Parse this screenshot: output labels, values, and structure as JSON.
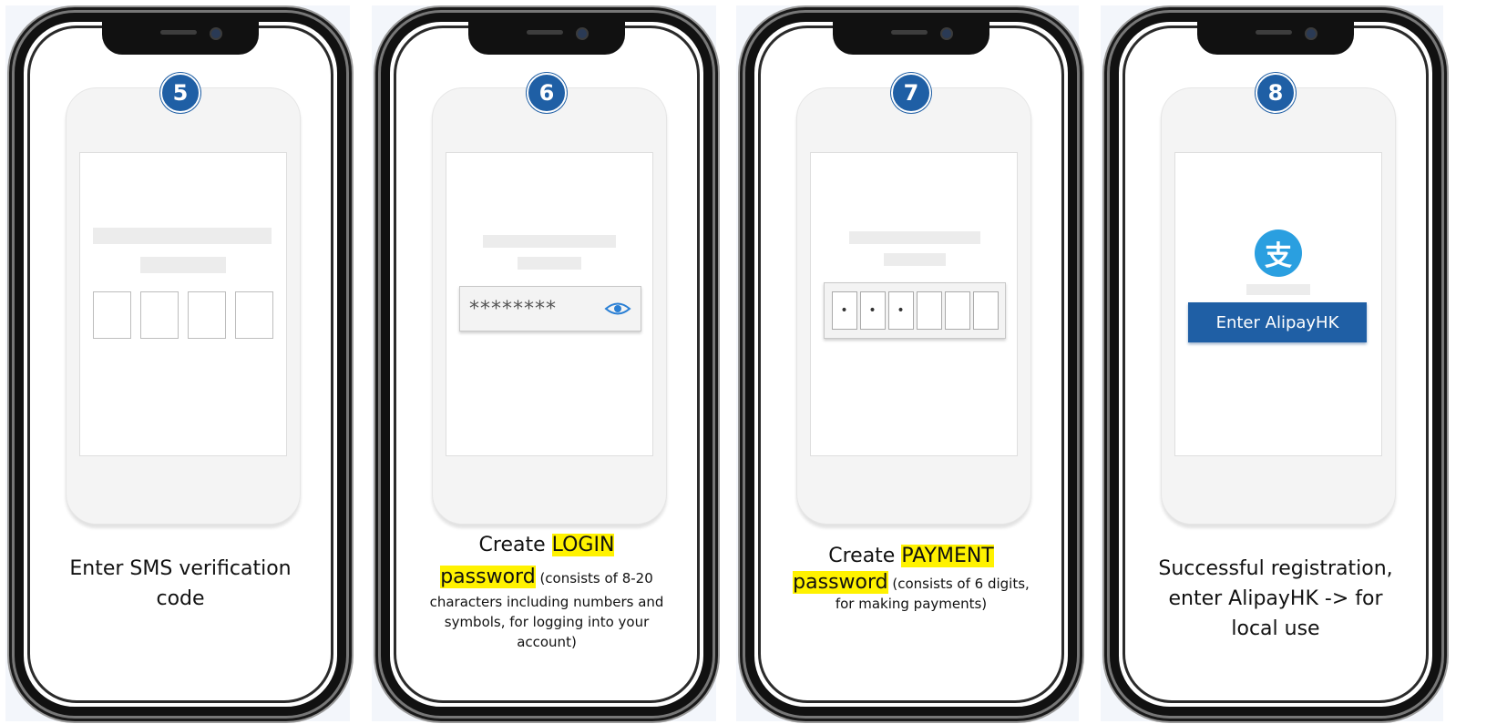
{
  "steps": [
    {
      "number": "5",
      "caption": "Enter SMS verification code"
    },
    {
      "number": "6",
      "caption_prefix": "Create ",
      "caption_highlight_1": "LOGIN",
      "caption_highlight_2": "password",
      "caption_detail": "(consists of 8-20 characters including numbers and symbols, for logging into your account)",
      "password_mask": "********"
    },
    {
      "number": "7",
      "caption_prefix": "Create ",
      "caption_highlight_1": "PAYMENT",
      "caption_highlight_2": "password",
      "caption_detail": "(consists of 6 digits, for making payments)",
      "pin_dots": [
        "•",
        "•",
        "•",
        "",
        "",
        ""
      ]
    },
    {
      "number": "8",
      "caption": "Successful registration, enter AlipayHK -> for local use",
      "logo_glyph": "支",
      "button_label": "Enter AlipayHK"
    }
  ],
  "colors": {
    "badge": "#1f5fa5",
    "button": "#1f5fa5",
    "highlight": "#fff200",
    "logo": "#2a9fe0"
  },
  "icons": [
    "eye-icon",
    "alipay-logo-icon"
  ]
}
